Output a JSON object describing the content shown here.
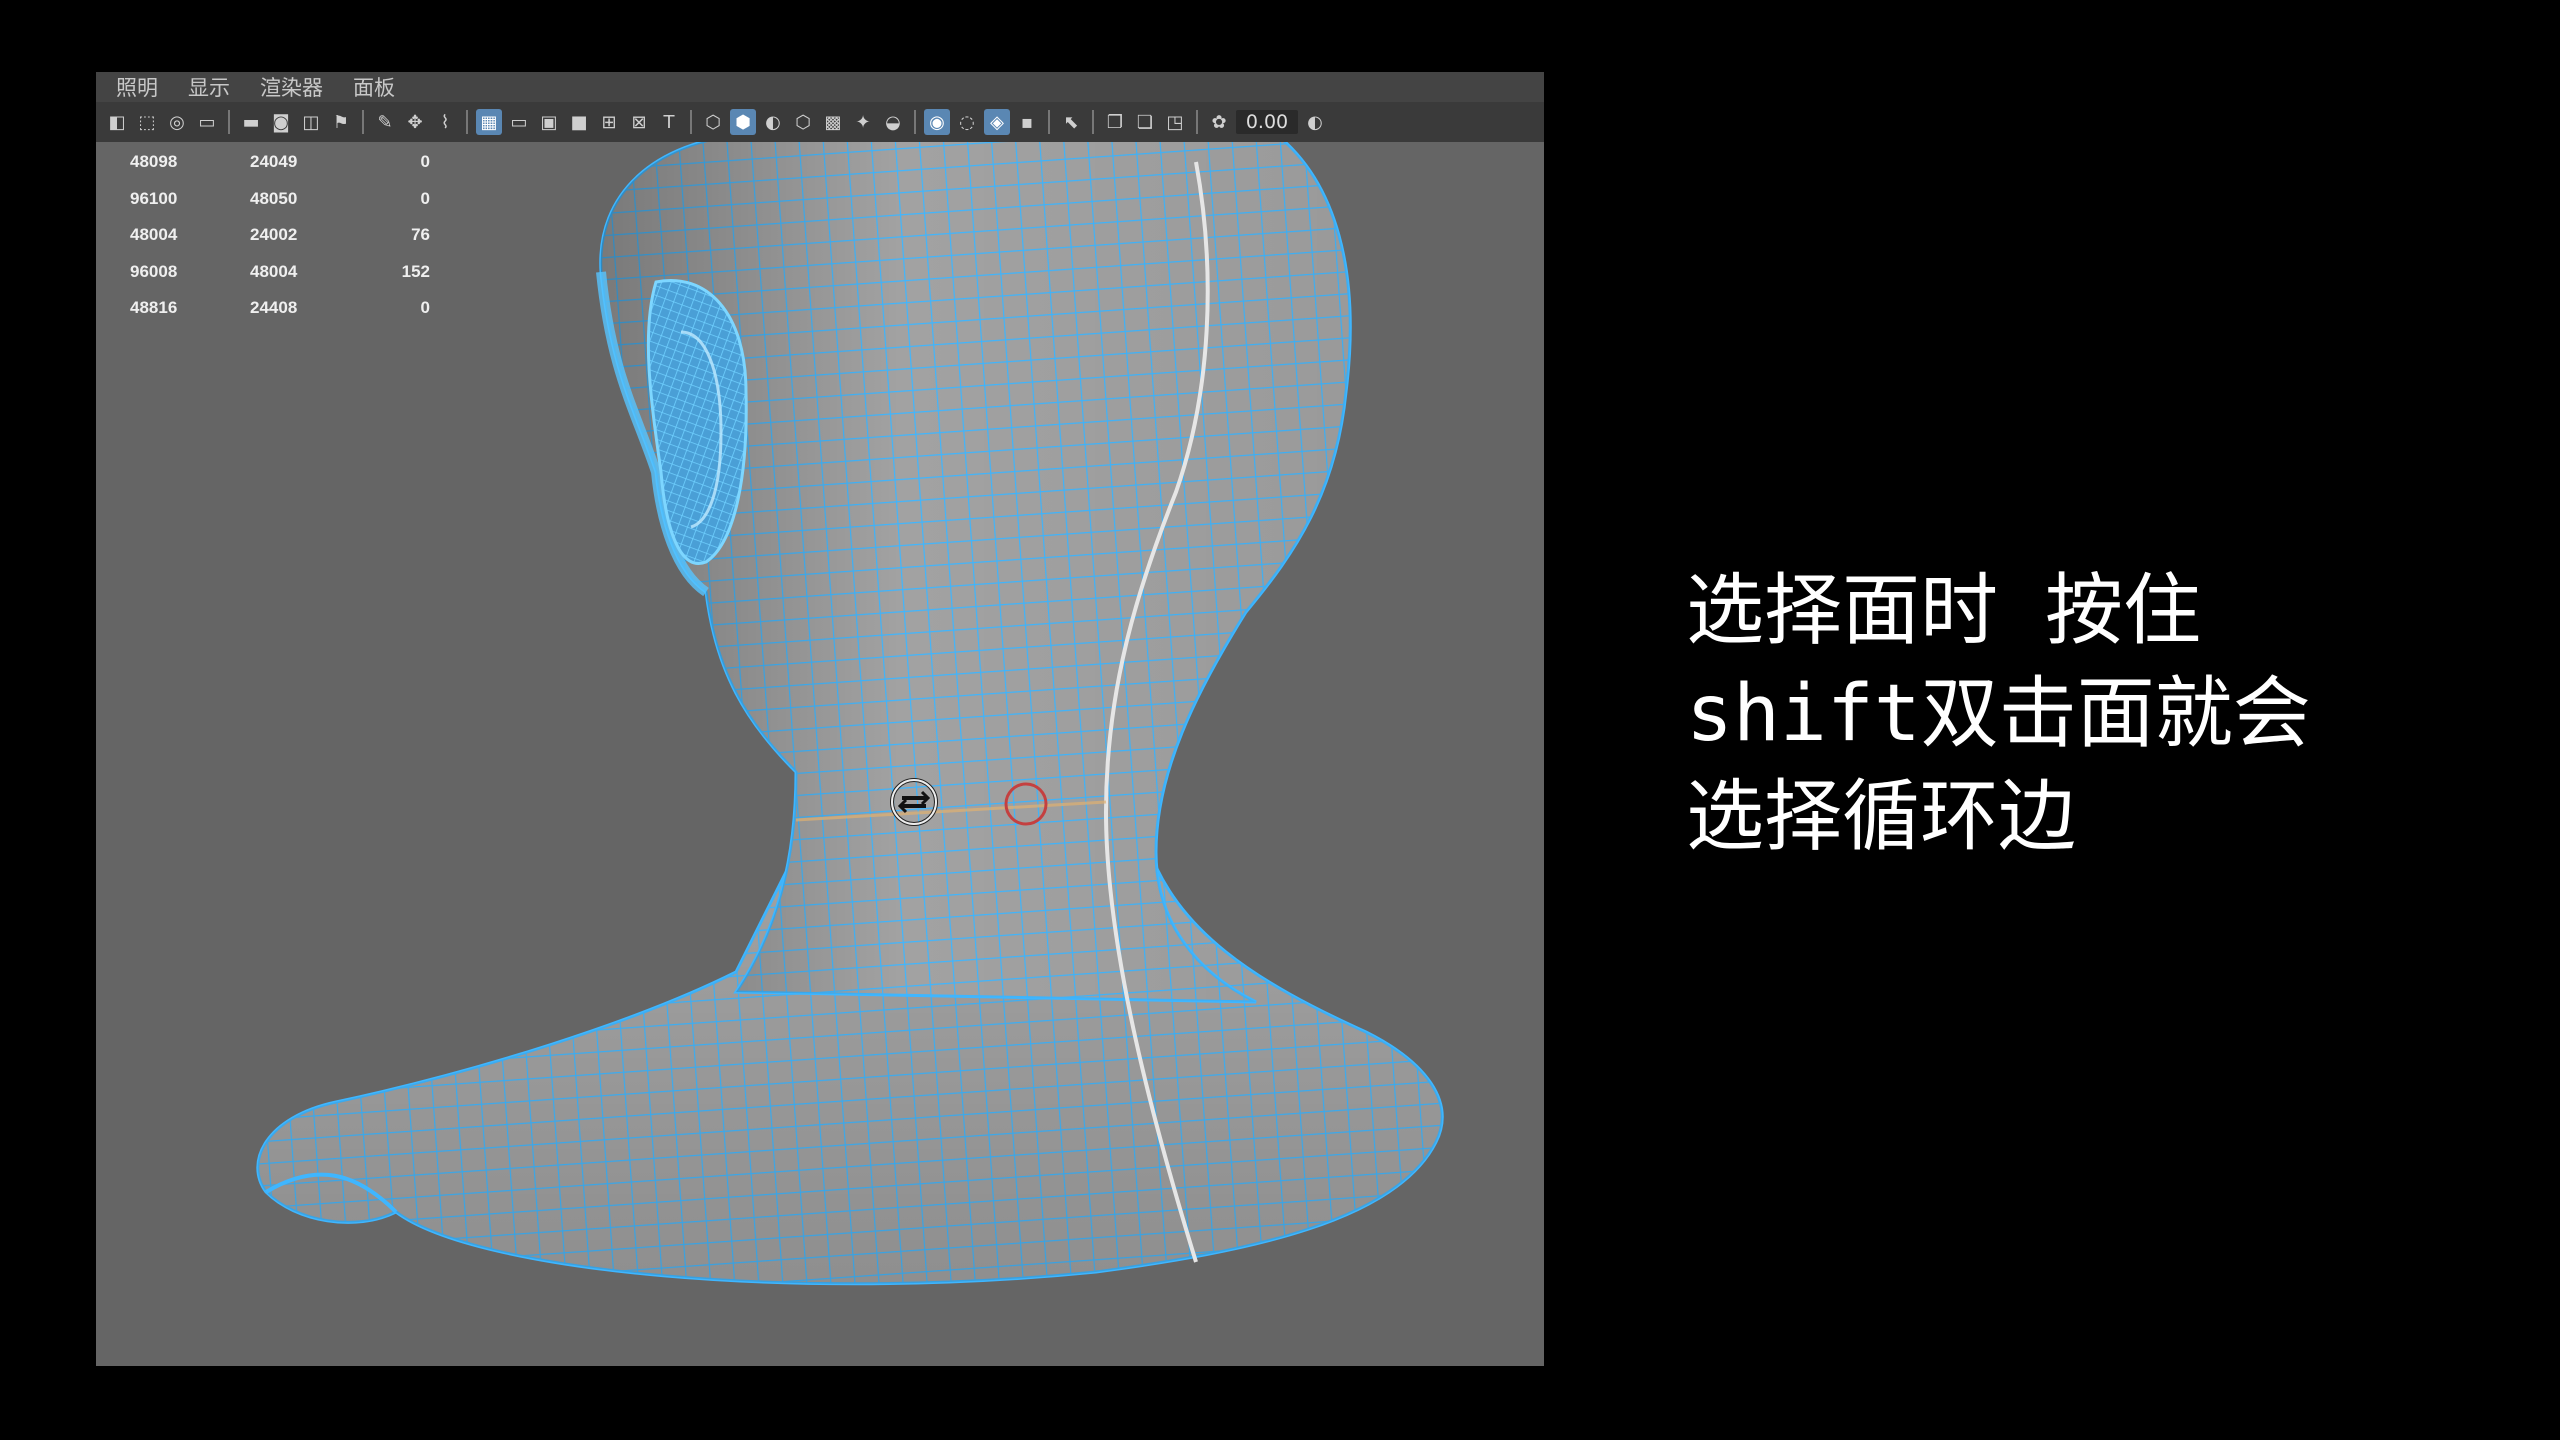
{
  "menubar": {
    "items": [
      "照明",
      "显示",
      "渲染器",
      "面板"
    ]
  },
  "toolbar": {
    "icons": [
      {
        "name": "camera-select-icon",
        "glyph": "◧",
        "active": false
      },
      {
        "name": "lock-camera-icon",
        "glyph": "⬚",
        "active": false
      },
      {
        "name": "bookmark-icon",
        "glyph": "◎",
        "active": false
      },
      {
        "name": "film-gate-icon",
        "glyph": "▭",
        "active": false
      },
      {
        "name": "sep"
      },
      {
        "name": "camera-icon",
        "glyph": "▬",
        "active": false
      },
      {
        "name": "camera-attr-icon",
        "glyph": "◙",
        "active": false
      },
      {
        "name": "image-plane-icon",
        "glyph": "◫",
        "active": false
      },
      {
        "name": "flag-icon",
        "glyph": "⚑",
        "active": false
      },
      {
        "name": "sep"
      },
      {
        "name": "grease-pencil-icon",
        "glyph": "✎",
        "active": false
      },
      {
        "name": "2d-pan-icon",
        "glyph": "✥",
        "active": false
      },
      {
        "name": "brush-icon",
        "glyph": "⌇",
        "active": false
      },
      {
        "name": "sep"
      },
      {
        "name": "grid-icon",
        "glyph": "▦",
        "active": true
      },
      {
        "name": "resolution-gate-icon",
        "glyph": "▭",
        "active": false
      },
      {
        "name": "gate-mask-icon",
        "glyph": "▣",
        "active": false
      },
      {
        "name": "field-chart-icon",
        "glyph": "■",
        "active": false
      },
      {
        "name": "safe-action-icon",
        "glyph": "⊞",
        "active": false
      },
      {
        "name": "safe-title-icon",
        "glyph": "⊠",
        "active": false
      },
      {
        "name": "text-icon",
        "glyph": "T",
        "active": false
      },
      {
        "name": "sep"
      },
      {
        "name": "wireframe-icon",
        "glyph": "⬡",
        "active": false
      },
      {
        "name": "smooth-shade-icon",
        "glyph": "⬢",
        "active": true
      },
      {
        "name": "default-material-icon",
        "glyph": "◐",
        "active": false
      },
      {
        "name": "wireframe-on-shaded-icon",
        "glyph": "⬡",
        "active": false
      },
      {
        "name": "textured-icon",
        "glyph": "▩",
        "active": false
      },
      {
        "name": "lights-icon",
        "glyph": "✦",
        "active": false
      },
      {
        "name": "shadows-icon",
        "glyph": "◒",
        "active": false
      },
      {
        "name": "sep"
      },
      {
        "name": "xray-icon",
        "glyph": "◉",
        "active": true
      },
      {
        "name": "xray-joints-icon",
        "glyph": "◌",
        "active": false
      },
      {
        "name": "isolate-select-icon",
        "glyph": "◈",
        "active": true
      },
      {
        "name": "ambient-occlusion-icon",
        "glyph": "▪",
        "active": false
      },
      {
        "name": "sep"
      },
      {
        "name": "select-camera-icon",
        "glyph": "⬉",
        "active": false
      },
      {
        "name": "sep"
      },
      {
        "name": "multisample-icon",
        "glyph": "❐",
        "active": false
      },
      {
        "name": "motion-blur-icon",
        "glyph": "❏",
        "active": false
      },
      {
        "name": "screen-space-icon",
        "glyph": "◳",
        "active": false
      },
      {
        "name": "sep"
      },
      {
        "name": "exposure-icon",
        "glyph": "✿",
        "active": false
      }
    ],
    "exposure_value": "0.00",
    "gamma_icon": "◐"
  },
  "hud": {
    "rows": [
      [
        "48098",
        "24049",
        "0"
      ],
      [
        "96100",
        "48050",
        "0"
      ],
      [
        "48004",
        "24002",
        "76"
      ],
      [
        "96008",
        "48004",
        "152"
      ],
      [
        "48816",
        "24408",
        "0"
      ]
    ]
  },
  "caption": {
    "lines": [
      "选择面时 按住",
      "shift双击面就会",
      "选择循环边"
    ]
  },
  "colors": {
    "background": "#000000",
    "viewport": "#656565",
    "wireframe": "#3fb6ff",
    "mesh_fill": "#9a9a9a",
    "seam": "#e6e6e6",
    "cursor_ring": "#c44040"
  }
}
